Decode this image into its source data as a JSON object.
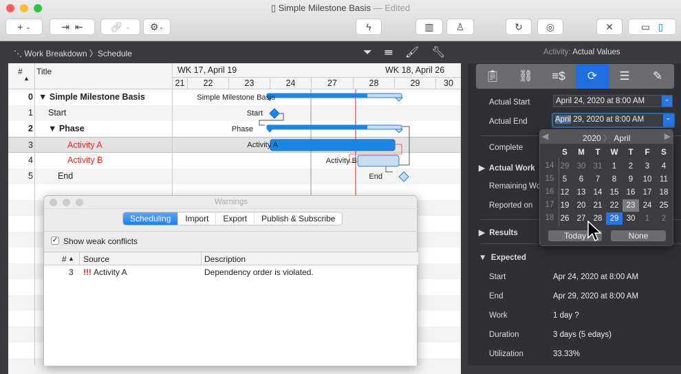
{
  "window": {
    "title": "Simple Milestone Basis",
    "status": "— Edited"
  },
  "toolbar": {
    "icons": [
      "plus-icon",
      "chevron-down-icon",
      "indent-icon",
      "outdent-icon",
      "link-icon",
      "chevron-down-icon",
      "gear-icon",
      "lightning-icon",
      "library-icon",
      "person-icon",
      "refresh-icon",
      "publish-icon",
      "tools-icon",
      "bottom-pane-icon",
      "right-pane-icon"
    ]
  },
  "nav": {
    "breadcrumb": [
      "Work Breakdown",
      "Schedule"
    ],
    "inspector_title_prefix": "Activity:",
    "inspector_title": "Actual Values"
  },
  "outline": {
    "col_num": "#",
    "col_title": "Title",
    "rows": [
      {
        "num": "0",
        "title": "Simple Milestone Basis",
        "bold": true,
        "red": false
      },
      {
        "num": "1",
        "title": "Start",
        "bold": false,
        "red": false
      },
      {
        "num": "2",
        "title": "Phase",
        "bold": true,
        "red": false
      },
      {
        "num": "3",
        "title": "Activity A",
        "bold": false,
        "red": true
      },
      {
        "num": "4",
        "title": "Activity B",
        "bold": false,
        "red": true
      },
      {
        "num": "5",
        "title": "End",
        "bold": false,
        "red": false
      }
    ]
  },
  "gantt": {
    "weeks": [
      "WK 17, April 19",
      "WK 18, April 26"
    ],
    "days": [
      "21",
      "22",
      "23",
      "24",
      "27",
      "28",
      "29",
      "30"
    ],
    "labels": [
      "Simple Milestone Basis",
      "Start",
      "Phase",
      "Activity A",
      "Activity B",
      "End"
    ]
  },
  "warnings": {
    "title": "Warnings",
    "tabs": [
      "Scheduling",
      "Import",
      "Export",
      "Publish & Subscribe"
    ],
    "active_tab": "Scheduling",
    "checkbox_label": "Show weak conflicts",
    "checked": true,
    "columns": [
      "#",
      "Source",
      "Description"
    ],
    "rows": [
      {
        "num": "3",
        "flag": "!!!",
        "source": "Activity A",
        "description": "Dependency order is violated."
      }
    ]
  },
  "inspector": {
    "tabs": [
      "clipboard-check-icon",
      "link-icon",
      "cost-icon",
      "progress-percent-icon",
      "list-icon",
      "pencil-icon"
    ],
    "active_tab": 3,
    "actual_start_label": "Actual Start",
    "actual_start": "April 24, 2020 at 8:00 AM",
    "actual_end_label": "Actual End",
    "actual_end_sel": "April",
    "actual_end_rest": " 29, 2020 at 8:00 AM",
    "complete": "Complete",
    "actual_work": "Actual Work",
    "remaining_work": "Remaining Wo",
    "reported_on": "Reported on",
    "results": "Results",
    "expected": "Expected",
    "expected_rows": [
      {
        "label": "Start",
        "value": "Apr 24, 2020 at 8:00 AM"
      },
      {
        "label": "End",
        "value": "Apr 29, 2020 at 8:00 AM"
      },
      {
        "label": "Work",
        "value": "1 day ?"
      },
      {
        "label": "Duration",
        "value": "3 days (5 edays)"
      },
      {
        "label": "Utilization",
        "value": "33.33%"
      }
    ]
  },
  "calendar": {
    "year": "2020",
    "month": "April",
    "weekdays": [
      "S",
      "M",
      "T",
      "W",
      "T",
      "F",
      "S"
    ],
    "weeks": [
      {
        "wk": "14",
        "days": [
          "29",
          "30",
          "31",
          "1",
          "2",
          "3",
          "4"
        ]
      },
      {
        "wk": "15",
        "days": [
          "5",
          "6",
          "7",
          "8",
          "9",
          "10",
          "11"
        ]
      },
      {
        "wk": "16",
        "days": [
          "12",
          "13",
          "14",
          "15",
          "16",
          "17",
          "18"
        ]
      },
      {
        "wk": "17",
        "days": [
          "19",
          "20",
          "21",
          "22",
          "23",
          "24",
          "25"
        ]
      },
      {
        "wk": "18",
        "days": [
          "26",
          "27",
          "28",
          "29",
          "30",
          "1",
          "2"
        ]
      }
    ],
    "today": "23",
    "selected": "29",
    "today_button": "Today",
    "none_button": "None"
  }
}
